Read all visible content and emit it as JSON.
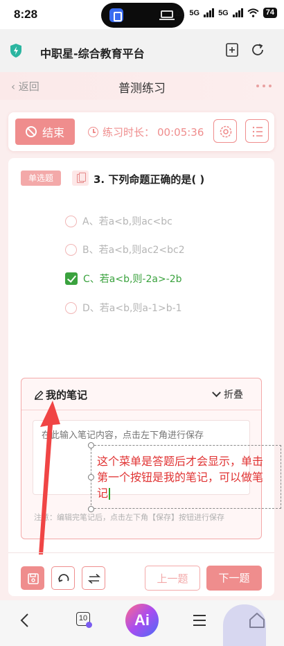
{
  "status_bar": {
    "time": "8:28",
    "network_1": "5G",
    "network_2": "5G",
    "battery": "74"
  },
  "browser": {
    "site_title": "中职星-综合教育平台"
  },
  "header": {
    "back_label": "返回",
    "title": "普测练习"
  },
  "controls": {
    "end_label": "结束",
    "timer_label": "练习时长：",
    "timer_value": "00:05:36"
  },
  "question": {
    "type_badge": "单选题",
    "text": "3. 下列命题正确的是( )",
    "options": [
      {
        "label": "A、若a<b,则ac<bc",
        "selected": false
      },
      {
        "label": "B、若a<b,则ac2<bc2",
        "selected": false
      },
      {
        "label": "C、若a<b,则-2a>-2b",
        "selected": true
      },
      {
        "label": "D、若a<b,则a-1>b-1",
        "selected": false
      }
    ]
  },
  "notes": {
    "title": "我的笔记",
    "fold_label": "折叠",
    "placeholder": "在此输入笔记内容，点击左下角进行保存",
    "hint": "注意：编辑完笔记后，点击左下角【保存】按钮进行保存"
  },
  "annotation": {
    "text": "这个菜单是答题后才会显示，单击第一个按钮是我的笔记，可以做笔记"
  },
  "actions": {
    "prev_label": "上一题",
    "next_label": "下一题"
  },
  "bottom_nav": {
    "tab_count": "10",
    "ai_label": "Ai"
  },
  "colors": {
    "accent": "#ef8d8d",
    "correct": "#3aa23e",
    "annotation": "#e03232"
  }
}
